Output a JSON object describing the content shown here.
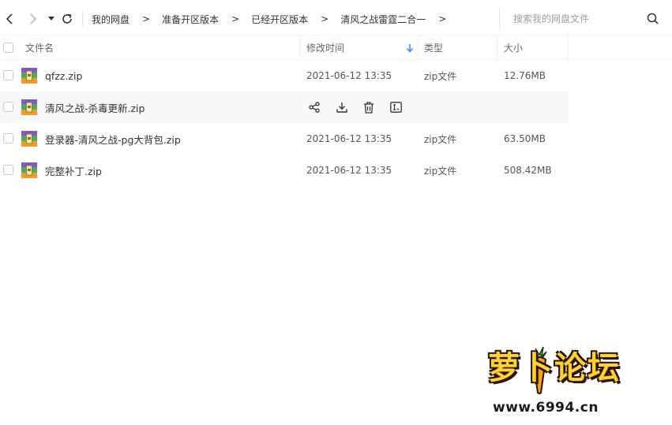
{
  "nav": {
    "back_icon": "chevron-left-icon",
    "forward_icon": "chevron-right-icon",
    "history_icon": "caret-down-icon",
    "refresh_icon": "refresh-icon"
  },
  "breadcrumb": {
    "items": [
      "我的网盘",
      "准备开区版本",
      "已经开区版本",
      "清风之战雷霆二合一"
    ],
    "separator": ">"
  },
  "search": {
    "placeholder": "搜索我的网盘文件",
    "value": ""
  },
  "columns": {
    "name": "文件名",
    "modified": "修改时间",
    "type": "类型",
    "size": "大小"
  },
  "files": [
    {
      "name": "qfzz.zip",
      "modified": "2021-06-12 13:35",
      "type": "zip文件",
      "size": "12.76MB"
    },
    {
      "name": "清风之战-杀毒更新.zip",
      "modified": "",
      "type": "",
      "size": ""
    },
    {
      "name": "登录器-清风之战-pg大背包.zip",
      "modified": "2021-06-12 13:35",
      "type": "zip文件",
      "size": "63.50MB"
    },
    {
      "name": "完整补丁.zip",
      "modified": "2021-06-12 13:35",
      "type": "zip文件",
      "size": "508.42MB"
    }
  ],
  "row_actions": [
    "share-icon",
    "download-icon",
    "delete-icon",
    "rename-icon"
  ],
  "watermark": {
    "logo_text": "萝卜论坛",
    "url": "www.6994.cn"
  },
  "colors": {
    "accent": "#2f8bf5",
    "hover_row": "#f7f8fa",
    "zip_icon_purple": "#7b5cc4",
    "zip_icon_green": "#4cb050",
    "zip_icon_orange": "#f39a2b",
    "watermark_yellow": "#ffd22e"
  }
}
